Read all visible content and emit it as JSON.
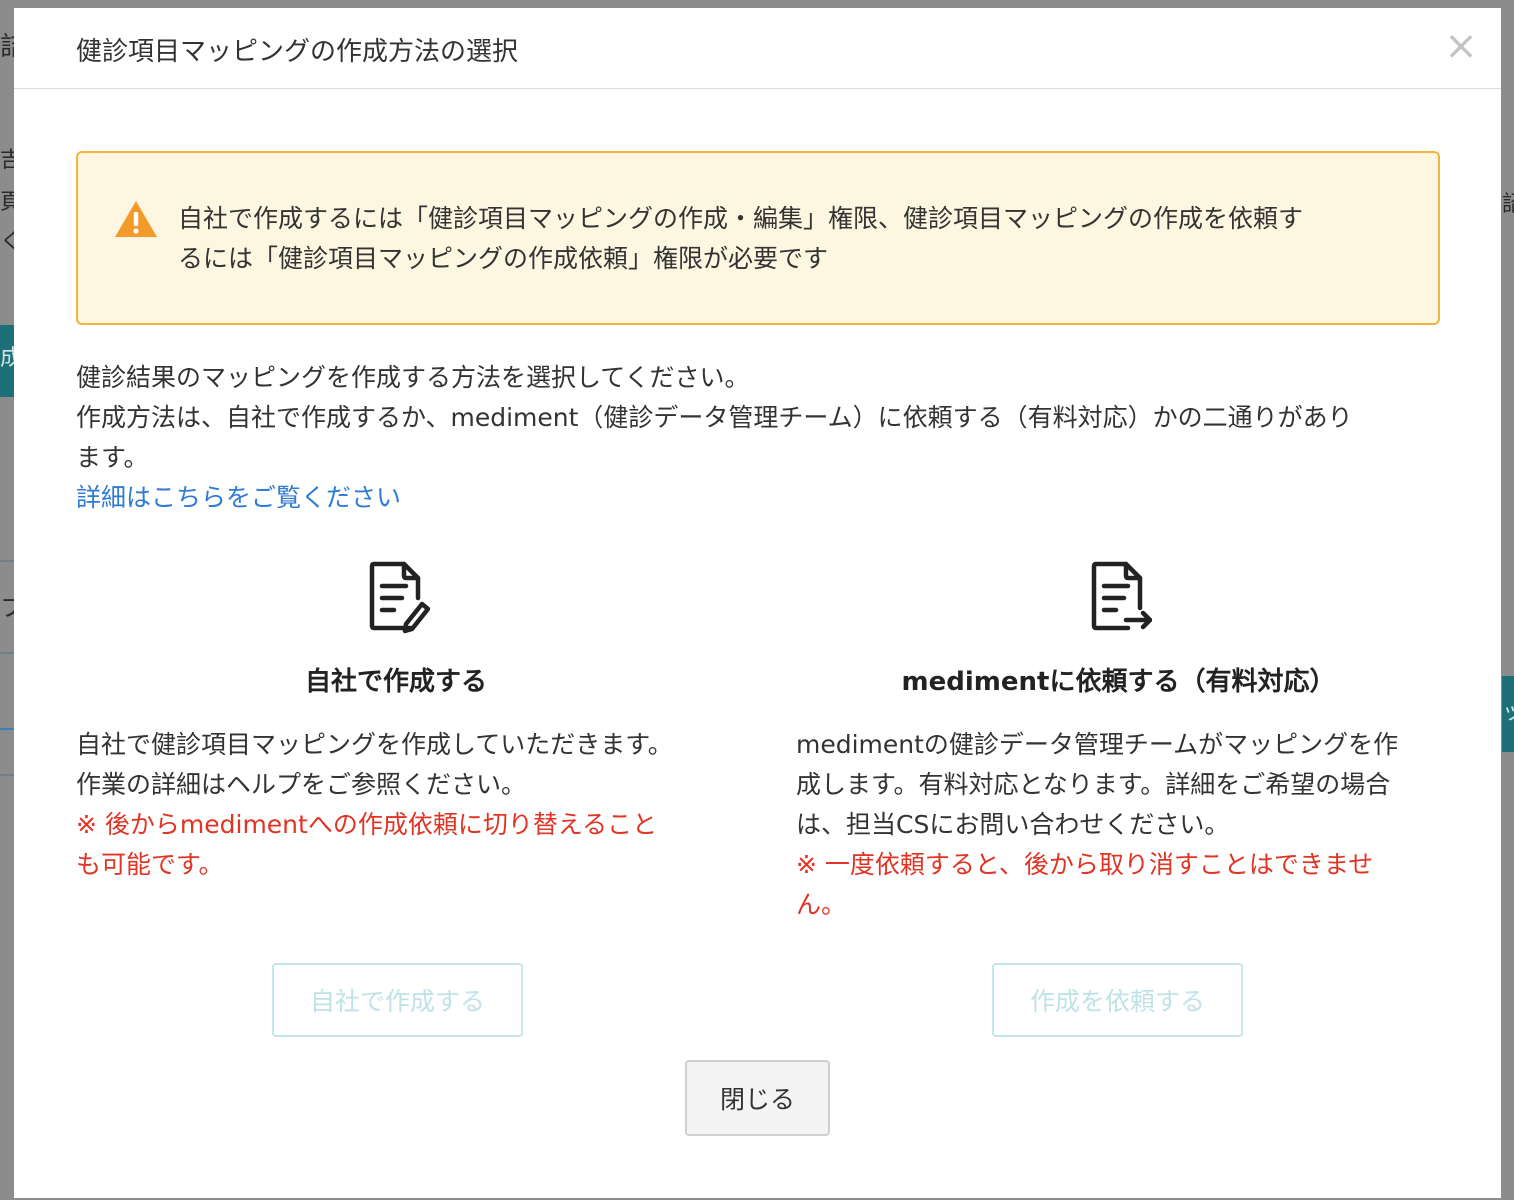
{
  "modal": {
    "title": "健診項目マッピングの作成方法の選択",
    "close_icon": "×"
  },
  "alert": {
    "icon": "warning-triangle-icon",
    "line1": "自社で作成するには「健診項目マッピングの作成・編集」権限、健診項目マッピングの作成を依頼す",
    "line2": "るには「健診項目マッピングの作成依頼」権限が必要です",
    "color_border": "#f3b33d",
    "color_bg": "#fdf7e1"
  },
  "description": {
    "line1": "健診結果のマッピングを作成する方法を選択してください。",
    "line2": "作成方法は、自社で作成するか、mediment（健診データ管理チーム）に依頼する（有料対応）かの二通りがあり",
    "line3": "ます。",
    "help_link": "詳細はこちらをご覧ください"
  },
  "options": {
    "self": {
      "icon": "document-edit-icon",
      "title": "自社で作成する",
      "body1": "自社で健診項目マッピングを作成していただきます。",
      "body2": "作業の詳細はヘルプをご参照ください。",
      "warn1": "※ 後からmedimentへの作成依頼に切り替えること",
      "warn2": "も可能です。",
      "button": "自社で作成する"
    },
    "request": {
      "icon": "document-send-icon",
      "title": "medimentに依頼する（有料対応）",
      "body1": "medimentの健診データ管理チームがマッピングを作",
      "body2": "成します。有料対応となります。詳細をご希望の場合",
      "body3": "は、担当CSにお問い合わせください。",
      "warn1": "※ 一度依頼すると、後から取り消すことはできませ",
      "warn2": "ん。",
      "button": "作成を依頼する"
    }
  },
  "footer": {
    "close_button": "閉じる"
  },
  "background": {
    "frag_top_left": "詰",
    "frag_left_1": "吉",
    "frag_left_2": "頁",
    "frag_left_3": "く",
    "frag_left_teal": "成",
    "frag_left_4": "フ",
    "frag_right_1": "詔",
    "frag_right_teal": "ッ"
  },
  "colors": {
    "warning": "#e03424",
    "link": "#2f7bd6",
    "disabled_button_border": "#c5e6ea",
    "disabled_button_text": "#bfe2e6",
    "background_teal": "#1f6f78"
  }
}
